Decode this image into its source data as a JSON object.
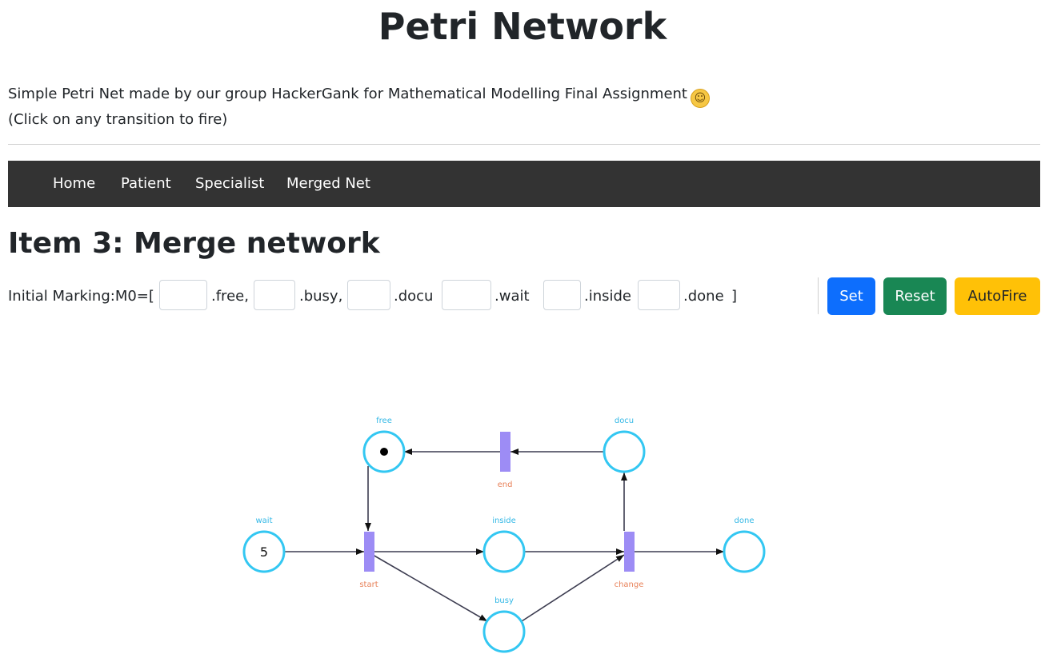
{
  "page": {
    "title": "Petri Network",
    "intro_line1": "Simple Petri Net made by our group HackerGank for Mathematical Modelling Final Assignment",
    "intro_emoji": "😇",
    "intro_line2": "(Click on any transition to fire)"
  },
  "nav": {
    "items": [
      "Home",
      "Patient",
      "Specialist",
      "Merged Net"
    ]
  },
  "section": {
    "title": "Item 3: Merge network"
  },
  "marking": {
    "prefix": "Initial Marking:M0=[",
    "suffixes": [
      ".free,",
      ".busy,",
      ".docu",
      ".wait",
      ".inside",
      ".done"
    ],
    "close": "]",
    "values": [
      "",
      "",
      "",
      "",
      "",
      ""
    ]
  },
  "buttons": {
    "set": "Set",
    "reset": "Reset",
    "autofire": "AutoFire"
  },
  "colors": {
    "place_stroke": "#33c7f2",
    "transition_fill": "#9d8cf5",
    "place_label": "#33b8e6",
    "transition_label": "#e8825a",
    "set_button": "#0d6efd",
    "reset_button": "#198754",
    "autofire_button": "#ffc107"
  },
  "net": {
    "places": [
      {
        "id": "free",
        "label": "free",
        "tokens": 1,
        "token_display": "dot"
      },
      {
        "id": "docu",
        "label": "docu",
        "tokens": 0
      },
      {
        "id": "wait",
        "label": "wait",
        "tokens": 5,
        "token_display": "5"
      },
      {
        "id": "inside",
        "label": "inside",
        "tokens": 0
      },
      {
        "id": "done",
        "label": "done",
        "tokens": 0
      },
      {
        "id": "busy",
        "label": "busy",
        "tokens": 0
      }
    ],
    "transitions": [
      {
        "id": "end",
        "label": "end"
      },
      {
        "id": "start",
        "label": "start"
      },
      {
        "id": "change",
        "label": "change"
      }
    ],
    "arcs": [
      {
        "from": "docu",
        "to": "end"
      },
      {
        "from": "end",
        "to": "free"
      },
      {
        "from": "free",
        "to": "start"
      },
      {
        "from": "wait",
        "to": "start"
      },
      {
        "from": "start",
        "to": "inside"
      },
      {
        "from": "start",
        "to": "busy"
      },
      {
        "from": "inside",
        "to": "change"
      },
      {
        "from": "busy",
        "to": "change"
      },
      {
        "from": "change",
        "to": "done"
      },
      {
        "from": "change",
        "to": "docu"
      }
    ]
  }
}
